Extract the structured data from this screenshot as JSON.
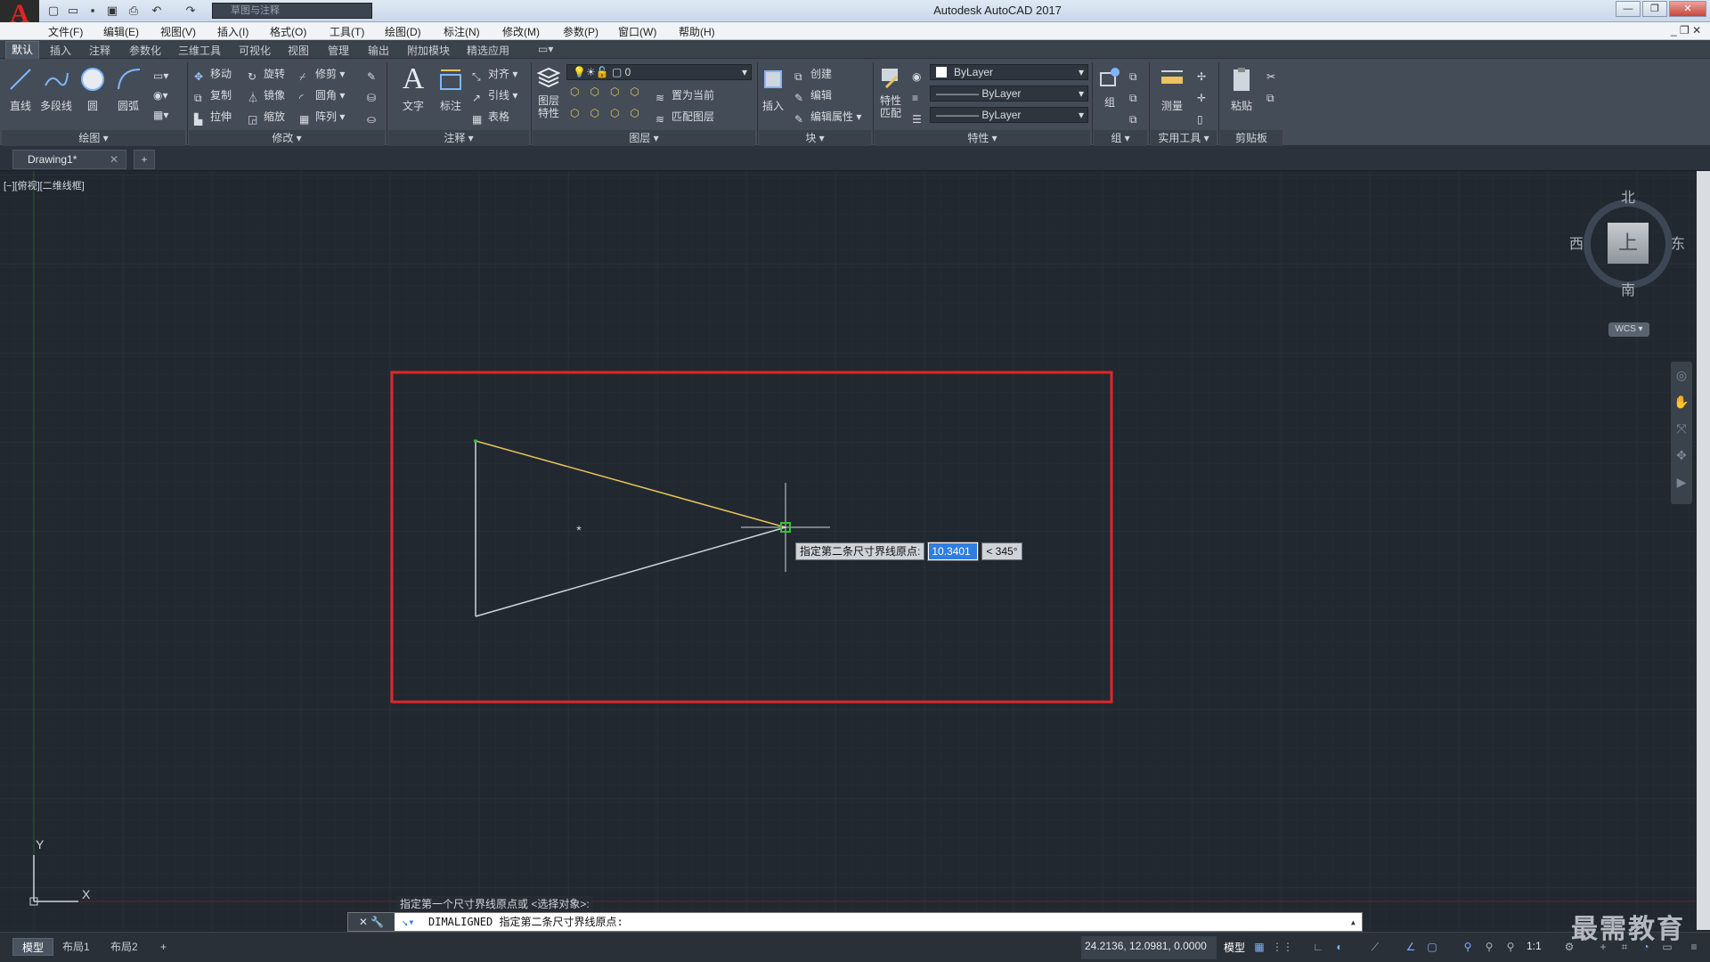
{
  "titlebar": {
    "app_title": "Autodesk AutoCAD 2017",
    "workspace": "草图与注释",
    "logo_letter": "A"
  },
  "menubar": {
    "items": [
      "文件(F)",
      "编辑(E)",
      "视图(V)",
      "插入(I)",
      "格式(O)",
      "工具(T)",
      "绘图(D)",
      "标注(N)",
      "修改(M)",
      "参数(P)",
      "窗口(W)",
      "帮助(H)"
    ]
  },
  "ribbon_tabs": [
    "默认",
    "插入",
    "注释",
    "参数化",
    "三维工具",
    "可视化",
    "视图",
    "管理",
    "输出",
    "附加模块",
    "精选应用"
  ],
  "ribbon": {
    "draw": {
      "line": "直线",
      "polyline": "多段线",
      "circle": "圆",
      "arc": "圆弧",
      "label": "绘图"
    },
    "modify": {
      "move": "移动",
      "rotate": "旋转",
      "trim": "修剪",
      "copy": "复制",
      "mirror": "镜像",
      "fillet": "圆角",
      "stretch": "拉伸",
      "scale": "缩放",
      "array": "阵列",
      "label": "修改"
    },
    "annotation": {
      "text": "文字",
      "dimension": "标注",
      "align": "对齐",
      "leader": "引线",
      "table": "表格",
      "label": "注释"
    },
    "layers": {
      "layer_props": "图层特性",
      "current_layer": "0",
      "set_current": "置为当前",
      "match_layer": "匹配图层",
      "label": "图层"
    },
    "block": {
      "insert": "插入",
      "create": "创建",
      "edit": "编辑",
      "edit_attr": "编辑属性",
      "label": "块"
    },
    "properties": {
      "match": "特性匹配",
      "color": "ByLayer",
      "linetype": "ByLayer",
      "lineweight": "ByLayer",
      "label": "特性"
    },
    "groups": {
      "group": "组",
      "label": "组"
    },
    "utilities": {
      "measure": "测量",
      "label": "实用工具"
    },
    "clipboard": {
      "paste": "粘贴",
      "label": "剪贴板"
    }
  },
  "doc_tab": {
    "name": "Drawing1*"
  },
  "viewport": {
    "label": "[−][俯视][二维线框]"
  },
  "viewcube": {
    "north": "北",
    "south": "南",
    "east": "东",
    "west": "西",
    "top": "上",
    "wcs": "WCS"
  },
  "ucs": {
    "x": "X",
    "y": "Y"
  },
  "dynamic_input": {
    "prompt": "指定第二条尺寸界线原点:",
    "value": "10.3401",
    "angle": "< 345°"
  },
  "command": {
    "history": "指定第一个尺寸界线原点或 <选择对象>:",
    "current": "DIMALIGNED 指定第二条尺寸界线原点:"
  },
  "layout_tabs": [
    "模型",
    "布局1",
    "布局2"
  ],
  "status": {
    "coords": "24.2136, 12.0981, 0.0000",
    "mode": "模型",
    "scale": "1:1"
  },
  "watermark": "最需教育"
}
